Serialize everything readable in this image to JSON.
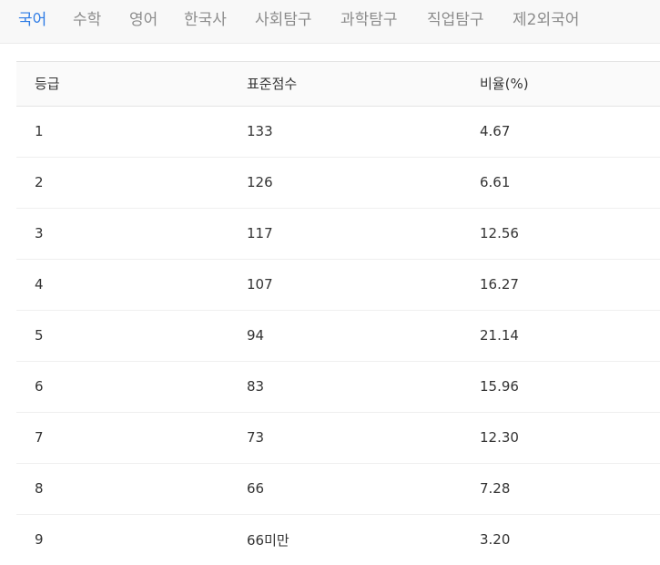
{
  "tabs": [
    {
      "label": "국어",
      "active": true
    },
    {
      "label": "수학",
      "active": false
    },
    {
      "label": "영어",
      "active": false
    },
    {
      "label": "한국사",
      "active": false
    },
    {
      "label": "사회탐구",
      "active": false
    },
    {
      "label": "과학탐구",
      "active": false
    },
    {
      "label": "직업탐구",
      "active": false
    },
    {
      "label": "제2외국어",
      "active": false
    }
  ],
  "colors": {
    "active_tab": "#2d7be5",
    "inactive_tab": "#8c8c8c",
    "tab_bar_bg": "#f8f8f8",
    "header_bg": "#fafafa"
  },
  "table": {
    "headers": [
      "등급",
      "표준점수",
      "비율(%)"
    ],
    "rows": [
      [
        "1",
        "133",
        "4.67"
      ],
      [
        "2",
        "126",
        "6.61"
      ],
      [
        "3",
        "117",
        "12.56"
      ],
      [
        "4",
        "107",
        "16.27"
      ],
      [
        "5",
        "94",
        "21.14"
      ],
      [
        "6",
        "83",
        "15.96"
      ],
      [
        "7",
        "73",
        "12.30"
      ],
      [
        "8",
        "66",
        "7.28"
      ],
      [
        "9",
        "66미만",
        "3.20"
      ]
    ]
  }
}
